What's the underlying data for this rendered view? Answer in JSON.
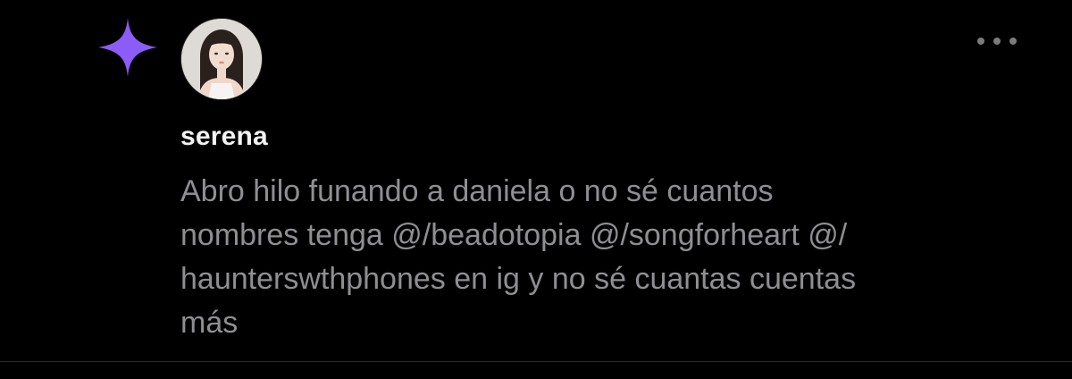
{
  "post": {
    "author": "serena",
    "text_lines": [
      "Abro hilo funando a daniela o no sé cuantos",
      "nombres tenga @/beadotopia @/songforheart @/",
      "haunterswthphones en ig y no sé cuantas cuentas",
      "más"
    ]
  },
  "icons": {
    "badge": "sparkle-icon",
    "menu": "more-options-icon"
  },
  "colors": {
    "background": "#000000",
    "sparkle": "#8b5cf6",
    "username": "#f2f2f2",
    "body_text": "#8e8e93",
    "menu_dots": "#7b7b7b",
    "divider": "#2b2b2d"
  }
}
